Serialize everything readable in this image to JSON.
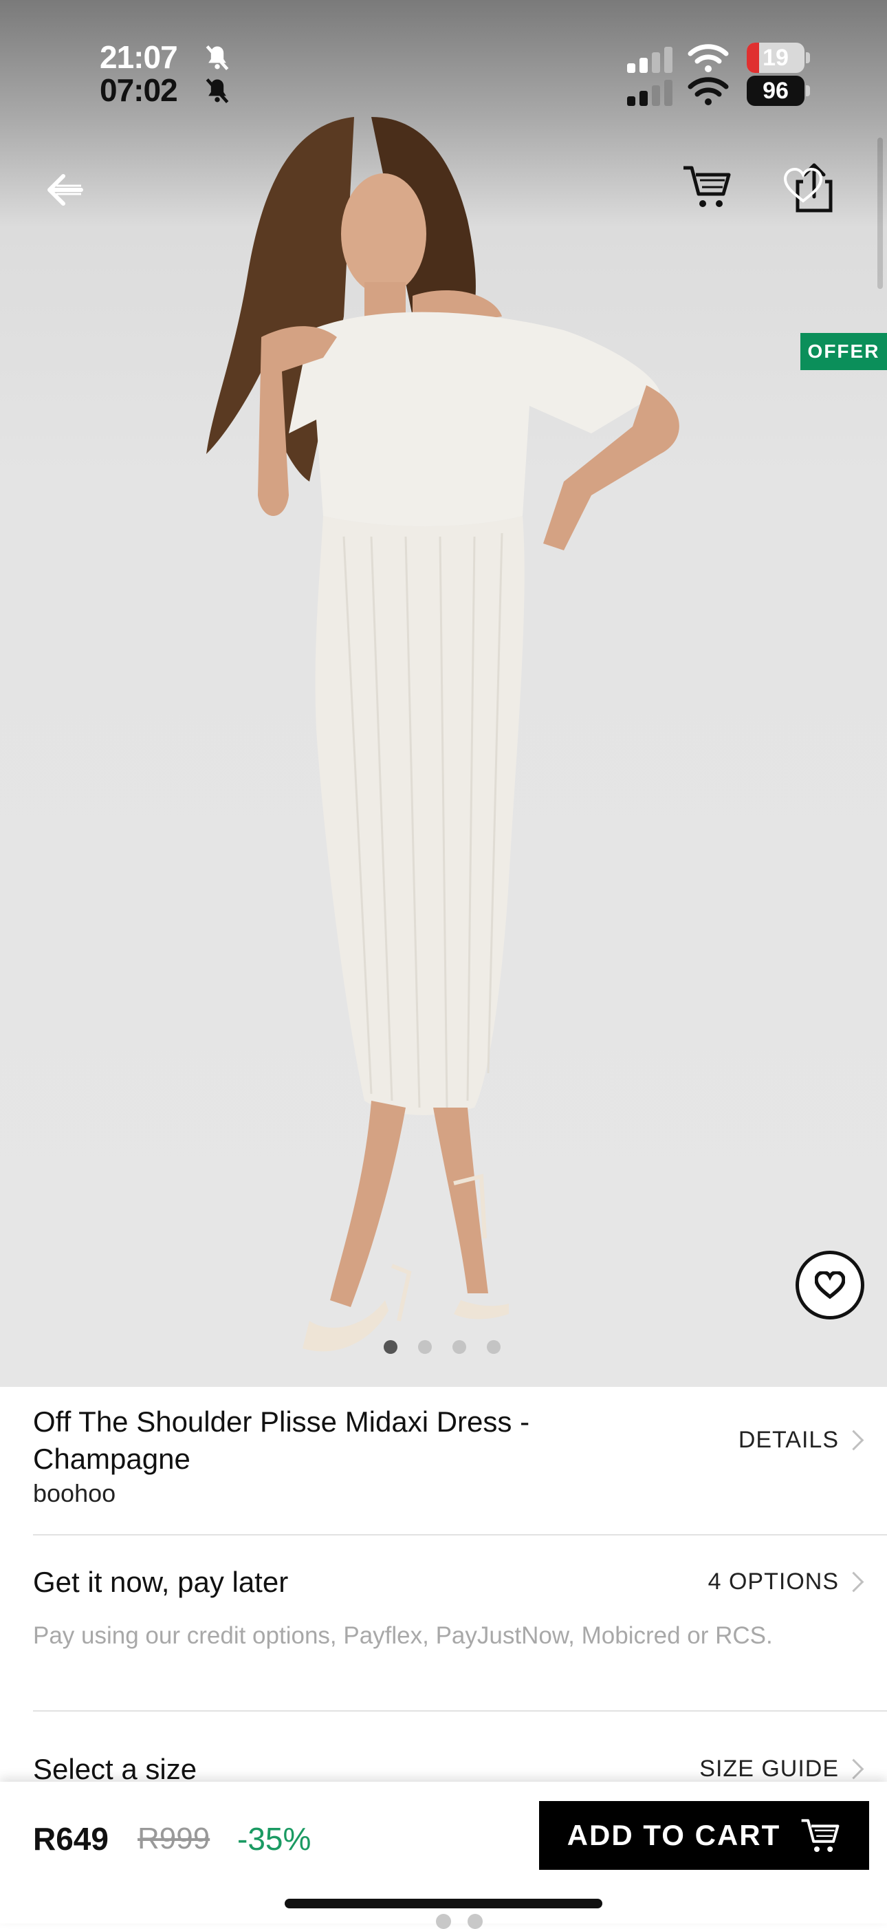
{
  "status_bar": {
    "time_primary": "21:07",
    "time_secondary": "07:02",
    "battery_primary": "19",
    "battery_secondary": "96"
  },
  "nav": {
    "back_icon": "back-arrow-icon",
    "cart_icon": "cart-icon",
    "share_icon": "share-icon",
    "wishlist_icon": "heart-icon"
  },
  "hero": {
    "badge": "OFFER",
    "carousel_total": 4,
    "carousel_active_index": 0
  },
  "product": {
    "title": "Off The Shoulder Plisse Midaxi Dress - Champagne",
    "brand": "boohoo",
    "details_link": "DETAILS"
  },
  "payment": {
    "heading": "Get it now, pay later",
    "options_link": "4 OPTIONS",
    "description": "Pay using our credit options, Payflex, PayJustNow, Mobicred or RCS."
  },
  "size": {
    "heading": "Select a size",
    "guide_link": "SIZE GUIDE"
  },
  "purchase": {
    "price": "R649",
    "original_price": "R999",
    "discount": "-35%",
    "add_to_cart": "ADD TO CART"
  },
  "colors": {
    "offer_badge": "#0b8f5a",
    "discount": "#1a9a62",
    "cart_button": "#000000"
  }
}
